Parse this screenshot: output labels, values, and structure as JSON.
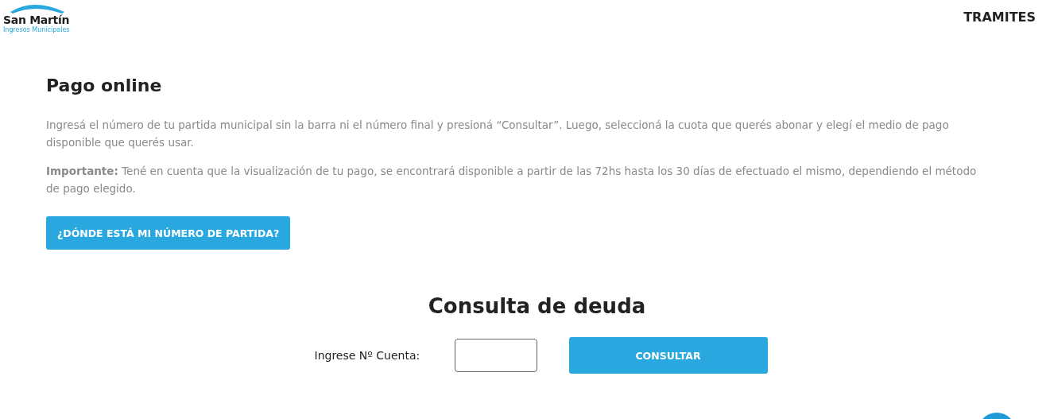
{
  "logo": {
    "title": "San Martín",
    "subtitle": "Ingresos Municipales"
  },
  "nav": [
    {
      "label": "TRAMITES"
    }
  ],
  "heading": "Pago online",
  "paragraphs": [
    "Ingresá el número de tu partida municipal sin la barra ni el número final y presioná “Consultar”. Luego, seleccioná la cuota que querés abonar y elegí el medio de pago disponible que querés usar.",
    "**Importante:** Tené en cuenta que la visualización de tu pago, se encontrará disponible a partir de las 72hs hasta los 30 días de efectuado el mismo, dependiendo el método de pago elegido."
  ],
  "help_button": "¿DÓNDE ESTÁ MI NÚMERO DE PARTIDA?",
  "form": {
    "title": "Consulta de deuda",
    "label": "Ingrese Nº Cuenta:",
    "submit": "CONSULTAR"
  }
}
